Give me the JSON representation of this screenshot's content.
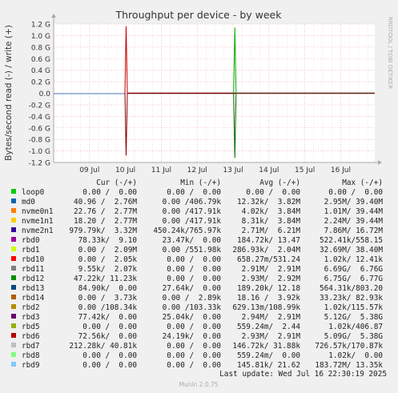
{
  "chart_data": {
    "type": "line",
    "title": "Throughput per device - by week",
    "ylabel": "Bytes/second read (-) / write (+)",
    "side_label": "RRDTOOL / TOBI OETIKER",
    "ylim": [
      -1.2,
      1.2
    ],
    "y_unit": "G",
    "y_ticks": [
      "1.2 G",
      "1.0 G",
      "0.8 G",
      "0.6 G",
      "0.4 G",
      "0.2 G",
      "0.0",
      "-0.2 G",
      "-0.4 G",
      "-0.6 G",
      "-0.8 G",
      "-1.0 G",
      "-1.2 G"
    ],
    "y_tick_values": [
      1.2,
      1.0,
      0.8,
      0.6,
      0.4,
      0.2,
      0.0,
      -0.2,
      -0.4,
      -0.6,
      -0.8,
      -1.0,
      -1.2
    ],
    "x_ticks": [
      "09 Jul",
      "10 Jul",
      "11 Jul",
      "12 Jul",
      "13 Jul",
      "14 Jul",
      "15 Jul",
      "16 Jul"
    ],
    "x_range_days": [
      8.0,
      16.95
    ],
    "x_tick_days": [
      9,
      10,
      11,
      12,
      13,
      14,
      15,
      16
    ],
    "grid": true,
    "spikes": [
      {
        "day": 10.02,
        "write": 1.16,
        "read": -1.08,
        "color_up": "#cc0000",
        "color_down": "#8a0000"
      },
      {
        "day": 13.05,
        "write": 1.14,
        "read": -1.12,
        "color_up": "#00aa00",
        "color_down": "#006600"
      }
    ],
    "legend_columns": [
      "Cur (-/+)",
      "Min (-/+)",
      "Avg (-/+)",
      "Max (-/+)"
    ],
    "series": [
      {
        "name": "loop0",
        "color": "#00cc00",
        "cur": "0.00 /  0.00",
        "min": "0.00 /  0.00",
        "avg": "0.00 /  0.00",
        "max": "0.00 /  0.00"
      },
      {
        "name": "md0",
        "color": "#0066b3",
        "cur": "40.96 /  2.76M",
        "min": "0.00 /406.79k",
        "avg": "12.32k/  3.82M",
        "max": "2.95M/ 39.40M"
      },
      {
        "name": "nvme0n1",
        "color": "#ff8000",
        "cur": "22.76 /  2.77M",
        "min": "0.00 /417.91k",
        "avg": "4.02k/  3.84M",
        "max": "1.01M/ 39.44M"
      },
      {
        "name": "nvme1n1",
        "color": "#ffcc00",
        "cur": "18.20 /  2.77M",
        "min": "0.00 /417.91k",
        "avg": "8.31k/  3.84M",
        "max": "2.24M/ 39.44M"
      },
      {
        "name": "nvme2n1",
        "color": "#330099",
        "cur": "979.79k/  3.32M",
        "min": "450.24k/765.97k",
        "avg": "2.71M/  6.21M",
        "max": "7.86M/ 16.72M"
      },
      {
        "name": "rbd0",
        "color": "#990099",
        "cur": "78.33k/  9.10",
        "min": "23.47k/  0.00",
        "avg": "184.72k/ 13.47",
        "max": "522.41k/558.15"
      },
      {
        "name": "rbd1",
        "color": "#ccff00",
        "cur": "0.00 /  2.09M",
        "min": "0.00 /551.98k",
        "avg": "286.93k/  2.04M",
        "max": "32.69M/ 38.40M"
      },
      {
        "name": "rbd10",
        "color": "#ff0000",
        "cur": "0.00 /  2.05k",
        "min": "0.00 /  0.00",
        "avg": "658.27m/531.24",
        "max": "1.02k/ 12.41k"
      },
      {
        "name": "rbd11",
        "color": "#808080",
        "cur": "9.55k/  2.07k",
        "min": "0.00 /  0.00",
        "avg": "2.91M/  2.91M",
        "max": "6.69G/  6.76G"
      },
      {
        "name": "rbd12",
        "color": "#008f00",
        "cur": "47.22k/ 11.23k",
        "min": "0.00 /  0.00",
        "avg": "2.93M/  2.92M",
        "max": "6.75G/  6.77G"
      },
      {
        "name": "rbd13",
        "color": "#00487d",
        "cur": "84.90k/  0.00",
        "min": "27.64k/  0.00",
        "avg": "189.20k/ 12.18",
        "max": "564.31k/803.20"
      },
      {
        "name": "rbd14",
        "color": "#b35a00",
        "cur": "0.00 /  3.73k",
        "min": "0.00 /  2.89k",
        "avg": "18.16 /  3.92k",
        "max": "33.23k/ 82.93k"
      },
      {
        "name": "rbd2",
        "color": "#b38f00",
        "cur": "0.00 /108.34k",
        "min": "0.00 /103.33k",
        "avg": "629.13m/108.99k",
        "max": "1.02k/115.57k"
      },
      {
        "name": "rbd3",
        "color": "#6b006b",
        "cur": "77.42k/  0.00",
        "min": "25.04k/  0.00",
        "avg": "2.94M/  2.91M",
        "max": "5.12G/  5.38G"
      },
      {
        "name": "rbd5",
        "color": "#8fb300",
        "cur": "0.00 /  0.00",
        "min": "0.00 /  0.00",
        "avg": "559.24m/  2.44",
        "max": "1.02k/406.87"
      },
      {
        "name": "rbd6",
        "color": "#b30000",
        "cur": "72.56k/  0.00",
        "min": "24.19k/  0.00",
        "avg": "2.93M/  2.91M",
        "max": "5.09G/  5.38G"
      },
      {
        "name": "rbd7",
        "color": "#bebebe",
        "cur": "212.28k/ 40.81k",
        "min": "0.00 /  0.00",
        "avg": "146.72k/ 31.88k",
        "max": "726.57k/170.87k"
      },
      {
        "name": "rbd8",
        "color": "#80ff80",
        "cur": "0.00 /  0.00",
        "min": "0.00 /  0.00",
        "avg": "559.24m/  0.00",
        "max": "1.02k/  0.00"
      },
      {
        "name": "rbd9",
        "color": "#80c9ff",
        "cur": "0.00 /  0.00",
        "min": "0.00 /  0.00",
        "avg": "145.81k/ 21.62",
        "max": "183.72M/ 13.35k"
      }
    ],
    "last_update": "Last update: Wed Jul 16 22:30:19 2025",
    "footer": "Munin 2.0.75"
  }
}
